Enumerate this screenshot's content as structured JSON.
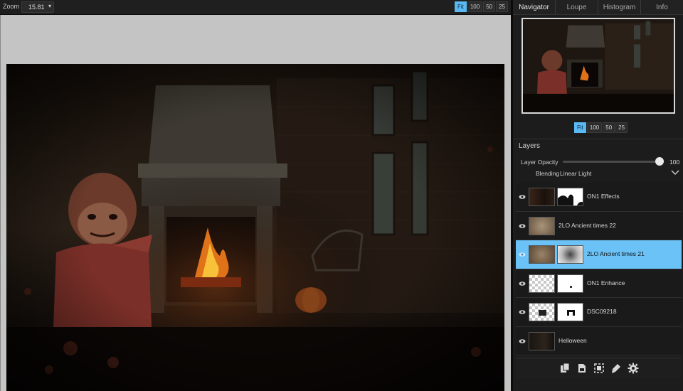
{
  "toolbar": {
    "zoom_label": "Zoom",
    "zoom_value": "15.81",
    "zoom_buttons": [
      "Fit",
      "100",
      "50",
      "25"
    ]
  },
  "tabs": [
    {
      "label": "Navigator",
      "active": true
    },
    {
      "label": "Loupe",
      "active": false
    },
    {
      "label": "Histogram",
      "active": false
    },
    {
      "label": "Info",
      "active": false
    }
  ],
  "navigator": {
    "zoom_buttons": [
      "Fit",
      "100",
      "50",
      "25"
    ]
  },
  "layers": {
    "title": "Layers",
    "opacity_label": "Layer Opacity",
    "opacity_value": "100",
    "opacity_level": 1.0,
    "blending_label": "Blending",
    "blending_value": "Linear Light",
    "items": [
      {
        "name": "ON1 Effects",
        "selected": false
      },
      {
        "name": "2LO Ancient times 22",
        "selected": false
      },
      {
        "name": "2LO Ancient times 21",
        "selected": true
      },
      {
        "name": "ON1 Enhance",
        "selected": false
      },
      {
        "name": "DSC09218",
        "selected": false
      },
      {
        "name": "Helloween",
        "selected": false
      }
    ]
  },
  "bottom_icons": [
    "duplicate-layer-icon",
    "new-layer-icon",
    "mask-icon",
    "brush-icon",
    "settings-gear-icon"
  ],
  "colors": {
    "accent": "#5ab9f2",
    "selected_row": "#6ac2f7",
    "panel_bg": "#1c1c1c"
  }
}
